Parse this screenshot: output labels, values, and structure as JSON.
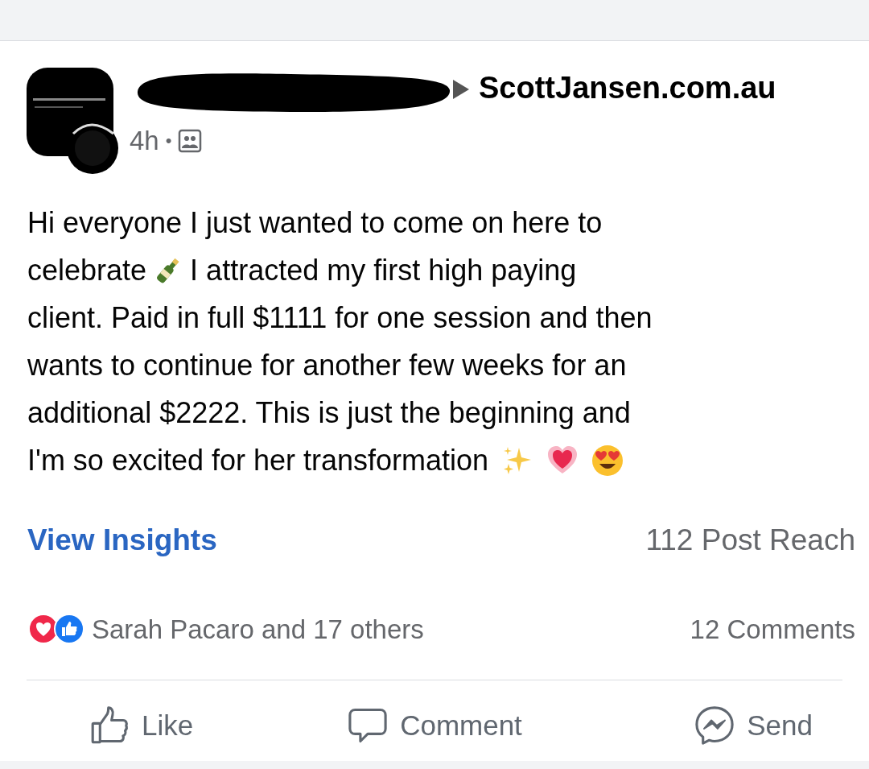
{
  "post": {
    "author_suffix": "ScottJansen.com.au",
    "time": "4h",
    "separator": "•",
    "body": [
      {
        "kind": "text",
        "text": "Hi everyone I just wanted to come on here to"
      },
      {
        "kind": "celebrate",
        "before": "celebrate",
        "after": "I attracted my first high paying"
      },
      {
        "kind": "text",
        "text": "client. Paid in full $1111 for one session and then"
      },
      {
        "kind": "text",
        "text": "wants to continue for another few weeks for an"
      },
      {
        "kind": "text",
        "text": "additional $2222. This is just the beginning and"
      },
      {
        "kind": "closing",
        "text": "I'm so excited for her transformation"
      }
    ]
  },
  "insights": {
    "link": "View Insights",
    "reach": "112 Post Reach"
  },
  "reactions": {
    "summary": "Sarah Pacaro and 17 others",
    "comments": "12 Comments"
  },
  "actions": [
    {
      "kind": "like",
      "label": "Like"
    },
    {
      "kind": "comment",
      "label": "Comment"
    },
    {
      "kind": "send",
      "label": "Send"
    }
  ]
}
